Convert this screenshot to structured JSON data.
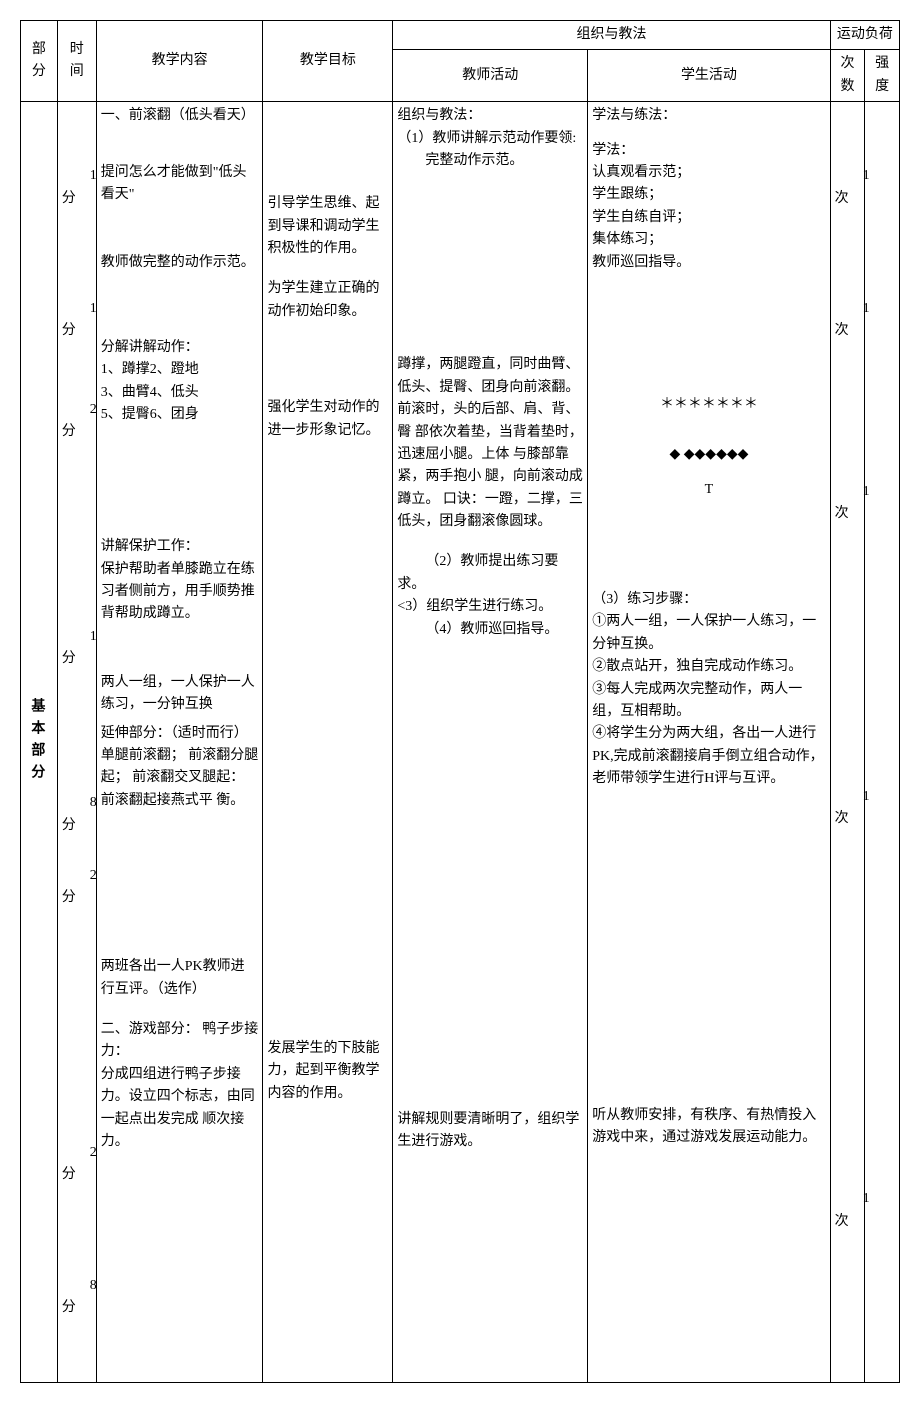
{
  "headers": {
    "part": "部\n分",
    "time": "时 间",
    "content": "教学内容",
    "goal": "教学目标",
    "org": "组织与教法",
    "teacher": "教师活动",
    "student": "学生活动",
    "load": "运动负荷",
    "count": "次数",
    "intensity": "强度"
  },
  "section_label": "基本部分",
  "times": {
    "t1": "1分",
    "t2": "1分",
    "t3": "2分",
    "t4": "1分",
    "t5": "8分",
    "t6": "2分",
    "t7": "2分",
    "t8": "8分"
  },
  "content": {
    "c1a": "一、前滚翻（低头看天）",
    "c1b": "提问怎么才能做到\"低头看天\"",
    "c2": "教师做完整的动作示范。",
    "c3a": "分解讲解动作：",
    "c3b": "1、蹲撑2、蹬地",
    "c3c": "3、曲臂4、低头",
    "c3d": "5、提臀6、团身",
    "c4a": "讲解保护工作：",
    "c4b": "保护帮助者单膝跪立在练习者侧前方，用手顺势推背帮助成蹲立。",
    "c5": "两人一组，一人保护一人练习，一分钟互换",
    "c6": "延伸部分：（适时而行） 单腿前滚翻； 前滚翻分腿起； 前滚翻交叉腿起： 前滚翻起接燕式平 衡。",
    "c7": "两班各出一人PK教师进行互评。（选作）",
    "c8a": "二、游戏部分： 鸭子步接力：",
    "c8b": "分成四组进行鸭子步接力。设立四个标志，由同一起点出发完成 顺次接力。"
  },
  "goal": {
    "g1": "引导学生思维、起到导课和调动学生积极性的作用。",
    "g2": "为学生建立正确的动作初始印象。",
    "g3": "强化学生对动作的进一步形象记忆。",
    "g8": "发展学生的下肢能力，起到平衡教学内容的作用。"
  },
  "teacher": {
    "t1a": "组织与教法：",
    "t1b": "（1）教师讲解示范动作要领:",
    "t1c": "完整动作示范。",
    "t3": "蹲撑，两腿蹬直，同时曲臂、低头、提臀、团身向前滚翻。前滚时，头的后部、肩、背、臀 部依次着垫，当背着垫时，迅速屈小腿。上体 与膝部靠紧，两手抱小 腿，向前滚动成蹲立。 口诀：一蹬，二撑，三 低头，团身翻滚像圆球。",
    "t4a": "（2）教师提出练习要求。",
    "t4b": "<3）组织学生进行练习。",
    "t4c": "（4）教师巡回指导。",
    "t8": "讲解规则要清晰明了，组织学生进行游戏。"
  },
  "student": {
    "s1a": "学法与练法：",
    "s1b": "学法：",
    "s1c": "认真观看示范；",
    "s1d": "学生跟练；",
    "s1e": "学生自练自评；",
    "s1f": "集体练习；",
    "s1g": "教师巡回指导。",
    "s3a": "＊＊＊＊＊＊＊",
    "s3b": "◆ ◆◆◆◆◆◆",
    "s3c": "T",
    "s4a": "（3）练习步骤：",
    "s4b": "①两人一组，一人保护一人练习，一分钟互换。",
    "s4c": "②散点站开，独自完成动作练习。",
    "s4d": "③每人完成两次完整动作，两人一组，互相帮助。",
    "s4e": "④将学生分为两大组，各出一人进行PK,完成前滚翻接肩手倒立组合动作，老师带领学生进行H评与互评。",
    "s8": "听从教师安排，有秩序、有热情投入游戏中来，通过游戏发展运动能力。"
  },
  "counts": {
    "n1": "1次",
    "n2": "1次",
    "n3": "1次",
    "n5": "1次",
    "n8": "1次"
  }
}
